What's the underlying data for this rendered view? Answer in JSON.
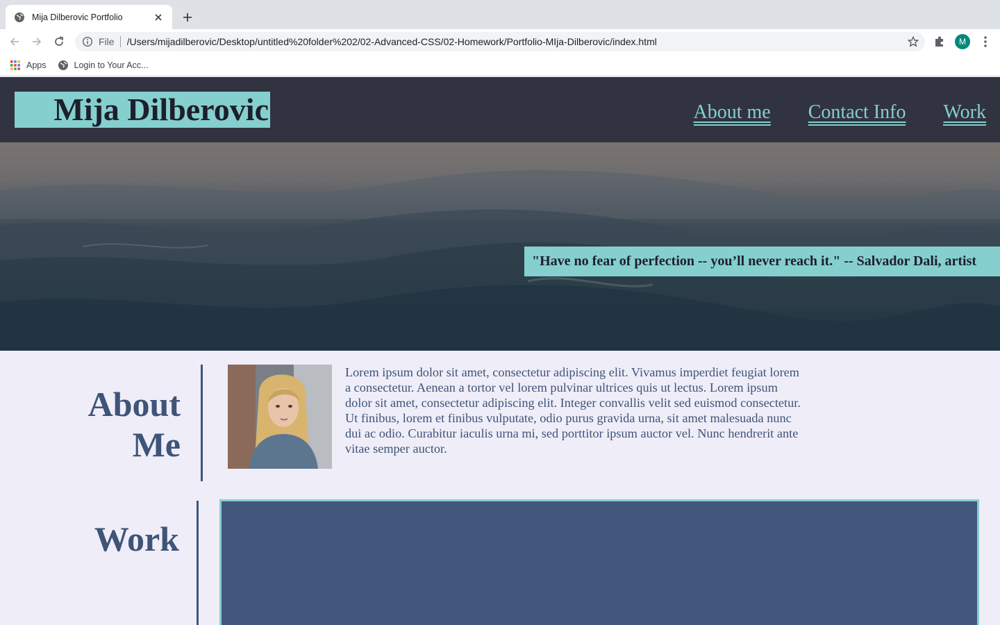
{
  "browser": {
    "tab_title": "Mija Dilberovic Portfolio",
    "scheme_label": "File",
    "url": "/Users/mijadilberovic/Desktop/untitled%20folder%202/02-Advanced-CSS/02-Homework/Portfolio-MIja-Dilberovic/index.html",
    "profile_initial": "M",
    "bookmarks": [
      {
        "label": "Apps",
        "icon": "apps-grid-icon"
      },
      {
        "label": "Login to Your Acc...",
        "icon": "globe-icon"
      }
    ]
  },
  "site": {
    "logo": "Mija Dilberovic",
    "nav": [
      {
        "label": "About me"
      },
      {
        "label": "Contact Info"
      },
      {
        "label": "Work"
      }
    ],
    "hero_quote": "\"Have no fear of perfection -- you’ll never reach it.\" -- Salvador Dali, artist",
    "about": {
      "heading": "About Me",
      "text": "Lorem ipsum dolor sit amet, consectetur adipiscing elit. Vivamus imperdiet feugiat lorem a consectetur. Aenean a tortor vel lorem pulvinar ultrices quis ut lectus. Lorem ipsum dolor sit amet, consectetur adipiscing elit. Integer convallis velit sed euismod consectetur. Ut finibus, lorem et finibus vulputate, odio purus gravida urna, sit amet malesuada nunc dui ac odio. Curabitur iaculis urna mi, sed porttitor ipsum auctor vel. Nunc hendrerit ante vitae semper auctor."
    },
    "work": {
      "heading": "Work"
    }
  },
  "colors": {
    "header_bg": "#313340",
    "accent": "#85cfcf",
    "text_blue": "#3e5478",
    "work_box": "#42577b",
    "page_bg": "#efedf8"
  }
}
